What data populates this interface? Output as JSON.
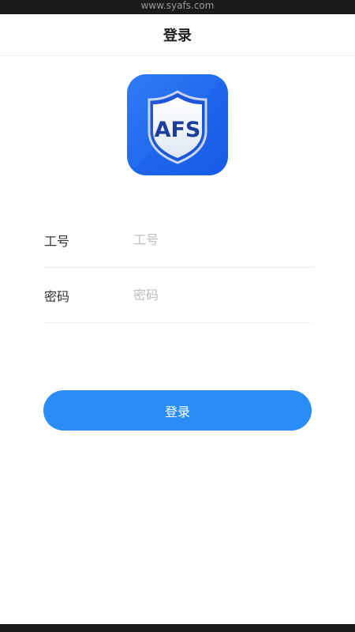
{
  "status_bar": {
    "url": "www.syafs.com"
  },
  "nav": {
    "title": "登录"
  },
  "logo": {
    "text": "AFS",
    "icon": "shield-icon",
    "bg_color": "#1e6bf0",
    "text_color": "#1c3e9c"
  },
  "form": {
    "id_label": "工号",
    "id_placeholder": "工号",
    "password_label": "密码",
    "password_placeholder": "密码"
  },
  "login_button": {
    "label": "登录",
    "color": "#2a8cf5"
  }
}
